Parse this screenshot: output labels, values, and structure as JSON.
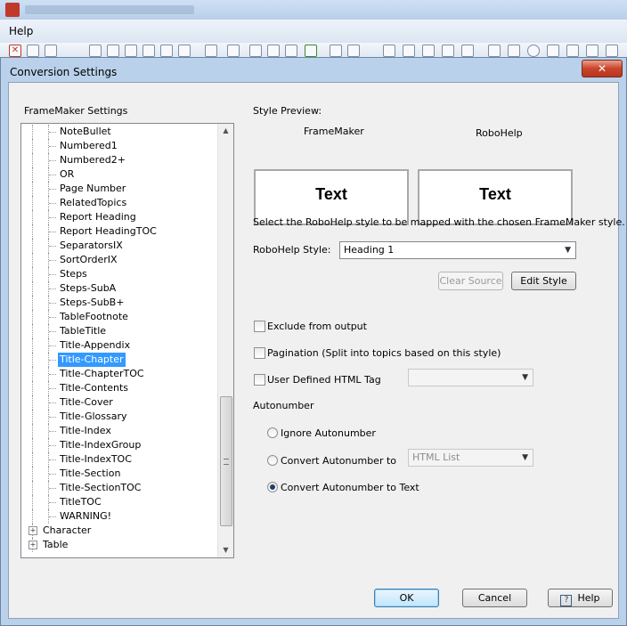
{
  "app": {
    "menu_help": "Help"
  },
  "dialog": {
    "title": "Conversion Settings",
    "close_label": "✕"
  },
  "tree": {
    "heading": "FrameMaker Settings",
    "items": [
      {
        "label": "NoteBullet",
        "level": 2
      },
      {
        "label": "Numbered1",
        "level": 2
      },
      {
        "label": "Numbered2+",
        "level": 2
      },
      {
        "label": "OR",
        "level": 2
      },
      {
        "label": "Page Number",
        "level": 2
      },
      {
        "label": "RelatedTopics",
        "level": 2
      },
      {
        "label": "Report Heading",
        "level": 2
      },
      {
        "label": "Report HeadingTOC",
        "level": 2
      },
      {
        "label": "SeparatorsIX",
        "level": 2
      },
      {
        "label": "SortOrderIX",
        "level": 2
      },
      {
        "label": "Steps",
        "level": 2
      },
      {
        "label": "Steps-SubA",
        "level": 2
      },
      {
        "label": "Steps-SubB+",
        "level": 2
      },
      {
        "label": "TableFootnote",
        "level": 2
      },
      {
        "label": "TableTitle",
        "level": 2
      },
      {
        "label": "Title-Appendix",
        "level": 2
      },
      {
        "label": "Title-Chapter",
        "level": 2,
        "selected": true
      },
      {
        "label": "Title-ChapterTOC",
        "level": 2
      },
      {
        "label": "Title-Contents",
        "level": 2
      },
      {
        "label": "Title-Cover",
        "level": 2
      },
      {
        "label": "Title-Glossary",
        "level": 2
      },
      {
        "label": "Title-Index",
        "level": 2
      },
      {
        "label": "Title-IndexGroup",
        "level": 2
      },
      {
        "label": "Title-IndexTOC",
        "level": 2
      },
      {
        "label": "Title-Section",
        "level": 2
      },
      {
        "label": "Title-SectionTOC",
        "level": 2
      },
      {
        "label": "TitleTOC",
        "level": 2
      },
      {
        "label": "WARNING!",
        "level": 2
      },
      {
        "label": "Character",
        "level": 1,
        "expander": "+"
      },
      {
        "label": "Table",
        "level": 1,
        "expander": "+"
      }
    ]
  },
  "preview": {
    "heading": "Style Preview:",
    "framemaker_label": "FrameMaker",
    "robohelp_label": "RoboHelp",
    "framemaker_text": "Text",
    "robohelp_text": "Text"
  },
  "mapping": {
    "instruction": "Select the RoboHelp style to be mapped with the chosen FrameMaker style.",
    "style_label": "RoboHelp Style:",
    "style_value": "Heading 1",
    "clear_source": "Clear Source",
    "edit_style": "Edit Style"
  },
  "options": {
    "exclude": "Exclude from output",
    "pagination": "Pagination (Split into topics based on this style)",
    "user_html_tag": "User Defined HTML Tag",
    "html_tag_value": ""
  },
  "autonumber": {
    "heading": "Autonumber",
    "ignore": "Ignore Autonumber",
    "convert_to": "Convert Autonumber to",
    "convert_to_value": "HTML List",
    "convert_text": "Convert Autonumber to Text",
    "selected": "convert_text"
  },
  "footer": {
    "ok": "OK",
    "cancel": "Cancel",
    "help": "Help"
  }
}
